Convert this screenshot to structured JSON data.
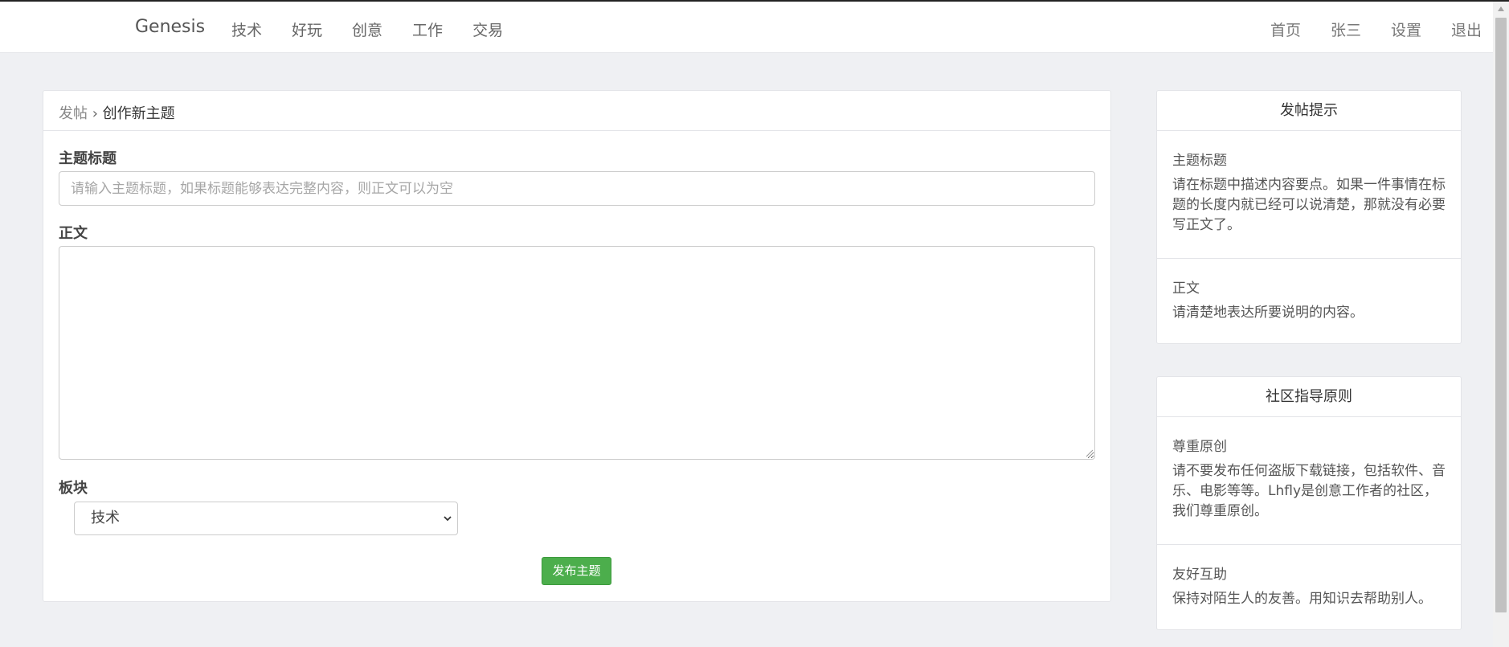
{
  "navbar": {
    "brand": "Genesis",
    "left_items": [
      "技术",
      "好玩",
      "创意",
      "工作",
      "交易"
    ],
    "right_items": [
      "首页",
      "张三",
      "设置",
      "退出"
    ]
  },
  "breadcrumb": {
    "parent": "发帖",
    "separator": "›",
    "current": "创作新主题"
  },
  "form": {
    "title_label": "主题标题",
    "title_placeholder": "请输入主题标题，如果标题能够表达完整内容，则正文可以为空",
    "title_value": "",
    "body_label": "正文",
    "body_value": "",
    "board_label": "板块",
    "board_selected": "技术",
    "submit_label": "发布主题"
  },
  "tips": {
    "title": "发帖提示",
    "sections": [
      {
        "heading": "主题标题",
        "text": "请在标题中描述内容要点。如果一件事情在标题的长度内就已经可以说清楚，那就没有必要写正文了。"
      },
      {
        "heading": "正文",
        "text": "请清楚地表达所要说明的内容。"
      }
    ]
  },
  "guidelines": {
    "title": "社区指导原则",
    "sections": [
      {
        "heading": "尊重原创",
        "text": "请不要发布任何盗版下载链接，包括软件、音乐、电影等等。Lhfly是创意工作者的社区，我们尊重原创。"
      },
      {
        "heading": "友好互助",
        "text": "保持对陌生人的友善。用知识去帮助别人。"
      }
    ]
  },
  "colors": {
    "accent_green": "#4cae4c",
    "page_bg": "#eff0f3"
  },
  "icons": {
    "select_arrow": "chevron-down-icon",
    "scroll_up": "scroll-up-arrow-icon"
  }
}
